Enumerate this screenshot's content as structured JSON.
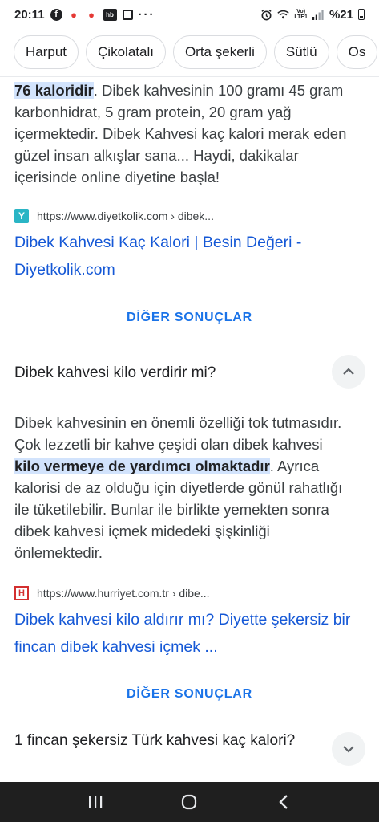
{
  "status_bar": {
    "time": "20:11",
    "icons": [
      "facebook-icon",
      "vodafone-icon",
      "vodafone-icon",
      "hb-icon",
      "app-box-icon",
      "more-dots-icon"
    ],
    "right_icons": [
      "alarm-icon",
      "wifi-icon",
      "volte-lte-icon",
      "signal-icon"
    ],
    "lte_top": "Vo)",
    "lte_bottom": "LTE1",
    "battery": "%21"
  },
  "chips": [
    "Harput",
    "Çikolatalı",
    "Orta şekerli",
    "Sütlü",
    "Os"
  ],
  "section1": {
    "highlight": "76 kaloridir",
    "text": ". Dibek kahvesinin 100 gramı 45 gram karbonhidrat, 5 gram protein, 20 gram yağ içermektedir. Dibek Kahvesi kaç kalori merak eden güzel insan alkışlar sana... Haydi, dakikalar içerisinde online diyetine başla!",
    "source_url": "https://www.diyetkolik.com › dibek...",
    "link": "Dibek Kahvesi Kaç Kalori | Besin Değeri - Diyetkolik.com",
    "more": "DİĞER SONUÇLAR"
  },
  "question1": {
    "title": "Dibek kahvesi kilo verdirir mi?",
    "text_before": "Dibek kahvesinin en önemli özelliği tok tutmasıdır. Çok lezzetli bir kahve çeşidi olan dibek kahvesi ",
    "highlight": "kilo vermeye de yardımcı olmaktadır",
    "text_after": ". Ayrıca kalorisi de az olduğu için diyetlerde gönül rahatlığı ile tüketilebilir. Bunlar ile birlikte yemekten sonra dibek kahvesi içmek midedeki şişkinliği önlemektedir.",
    "source_url": "https://www.hurriyet.com.tr › dibe...",
    "link": "Dibek kahvesi kilo aldırır mı? Diyette şekersiz bir fincan dibek kahvesi içmek ...",
    "more": "DİĞER SONUÇLAR"
  },
  "question2": {
    "title": "1 fincan şekersiz Türk kahvesi kaç kalori?"
  }
}
